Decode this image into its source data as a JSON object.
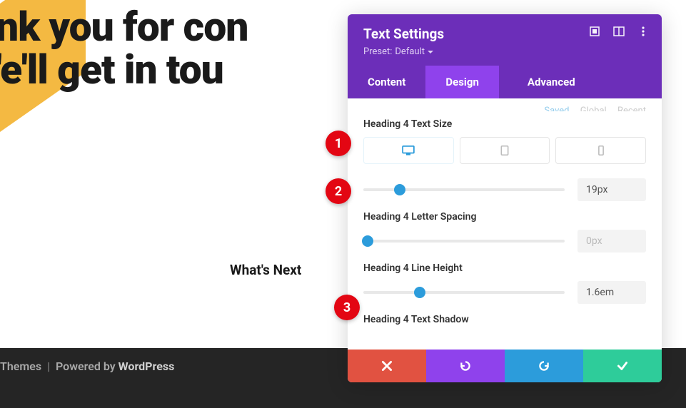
{
  "page": {
    "line1": "nk you for con",
    "line2": "'e'll get in tou",
    "whats_next": "What's Next",
    "footer_themes": "Themes",
    "footer_powered": "Powered by",
    "footer_wp": "WordPress"
  },
  "panel": {
    "title": "Text Settings",
    "preset_label": "Preset:",
    "preset_value": "Default",
    "tabs": {
      "content": "Content",
      "design": "Design",
      "advanced": "Advanced"
    },
    "toprow": {
      "saved": "Saved",
      "global": "Global",
      "recent": "Recent"
    },
    "options": {
      "text_size": {
        "label": "Heading 4 Text Size",
        "value": "19px",
        "thumb_pct": 18
      },
      "letter_spacing": {
        "label": "Heading 4 Letter Spacing",
        "value": "0px",
        "thumb_pct": 2
      },
      "line_height": {
        "label": "Heading 4 Line Height",
        "value": "1.6em",
        "thumb_pct": 28
      },
      "text_shadow": {
        "label": "Heading 4 Text Shadow"
      }
    }
  },
  "badges": {
    "b1": "1",
    "b2": "2",
    "b3": "3"
  }
}
